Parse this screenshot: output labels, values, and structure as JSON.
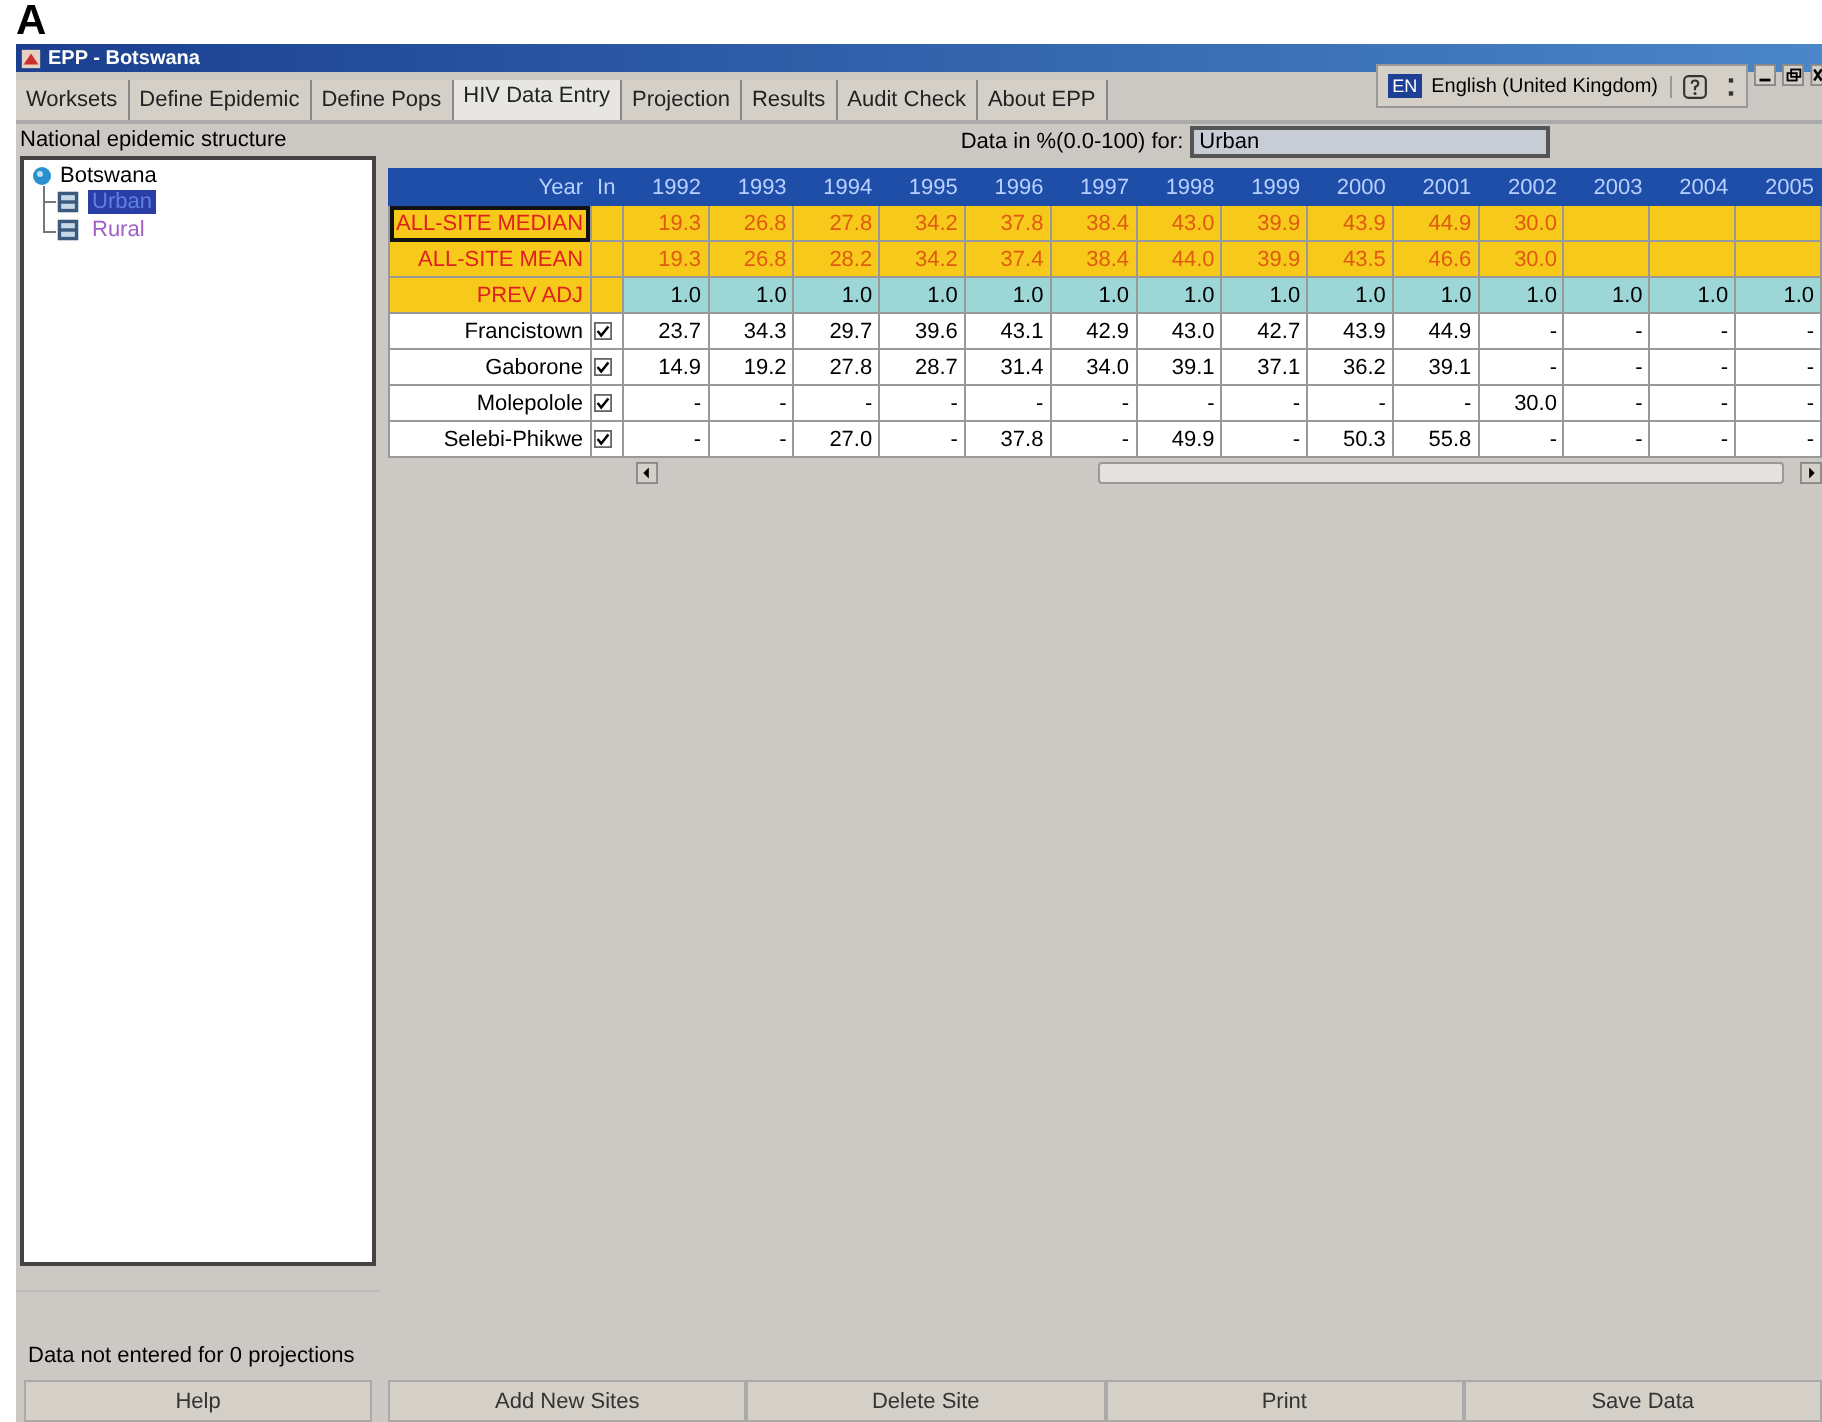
{
  "figure_label": "A",
  "window": {
    "title": "EPP - Botswana"
  },
  "language": {
    "code": "EN",
    "name": "English (United Kingdom)"
  },
  "tabs": [
    {
      "label": "Worksets",
      "selected": false
    },
    {
      "label": "Define Epidemic",
      "selected": false
    },
    {
      "label": "Define Pops",
      "selected": false
    },
    {
      "label": "HIV Data Entry",
      "selected": true
    },
    {
      "label": "Projection",
      "selected": false
    },
    {
      "label": "Results",
      "selected": false
    },
    {
      "label": "Audit Check",
      "selected": false
    },
    {
      "label": "About EPP",
      "selected": false
    }
  ],
  "sidebar": {
    "title": "National epidemic structure",
    "tree": {
      "label": "Botswana",
      "children": [
        {
          "label": "Urban",
          "selected": true
        },
        {
          "label": "Rural",
          "selected": false
        }
      ]
    },
    "status": "Data not entered for 0 projections",
    "button": "Help"
  },
  "data_for": {
    "label": "Data in %(0.0-100) for:",
    "value": "Urban"
  },
  "table": {
    "columns": [
      "Year",
      "In",
      "1992",
      "1993",
      "1994",
      "1995",
      "1996",
      "1997",
      "1998",
      "1999",
      "2000",
      "2001",
      "2002",
      "2003",
      "2004",
      "2005"
    ],
    "rows": [
      {
        "kind": "summary",
        "label": "ALL-SITE MEDIAN",
        "focused": true,
        "values": [
          "19.3",
          "26.8",
          "27.8",
          "34.2",
          "37.8",
          "38.4",
          "43.0",
          "39.9",
          "43.9",
          "44.9",
          "30.0"
        ]
      },
      {
        "kind": "summary",
        "label": "ALL-SITE MEAN",
        "focused": false,
        "values": [
          "19.3",
          "26.8",
          "28.2",
          "34.2",
          "37.4",
          "38.4",
          "44.0",
          "39.9",
          "43.5",
          "46.6",
          "30.0"
        ]
      },
      {
        "kind": "adjust",
        "label": "PREV ADJ",
        "values": [
          "1.0",
          "1.0",
          "1.0",
          "1.0",
          "1.0",
          "1.0",
          "1.0",
          "1.0",
          "1.0",
          "1.0",
          "1.0",
          "1.0",
          "1.0",
          "1.0"
        ]
      },
      {
        "kind": "site",
        "label": "Francistown",
        "checked": true,
        "values": [
          "23.7",
          "34.3",
          "29.7",
          "39.6",
          "43.1",
          "42.9",
          "43.0",
          "42.7",
          "43.9",
          "44.9",
          "-",
          "-",
          "-",
          "-"
        ]
      },
      {
        "kind": "site",
        "label": "Gaborone",
        "checked": true,
        "values": [
          "14.9",
          "19.2",
          "27.8",
          "28.7",
          "31.4",
          "34.0",
          "39.1",
          "37.1",
          "36.2",
          "39.1",
          "-",
          "-",
          "-",
          "-"
        ]
      },
      {
        "kind": "site",
        "label": "Molepolole",
        "checked": true,
        "values": [
          "-",
          "-",
          "-",
          "-",
          "-",
          "-",
          "-",
          "-",
          "-",
          "-",
          "30.0",
          "-",
          "-",
          "-"
        ]
      },
      {
        "kind": "site",
        "label": "Selebi-Phikwe",
        "checked": true,
        "values": [
          "-",
          "-",
          "27.0",
          "-",
          "37.8",
          "-",
          "49.9",
          "-",
          "50.3",
          "55.8",
          "-",
          "-",
          "-",
          "-"
        ]
      }
    ]
  },
  "buttons": [
    "Add New Sites",
    "Delete Site",
    "Print",
    "Save Data"
  ]
}
